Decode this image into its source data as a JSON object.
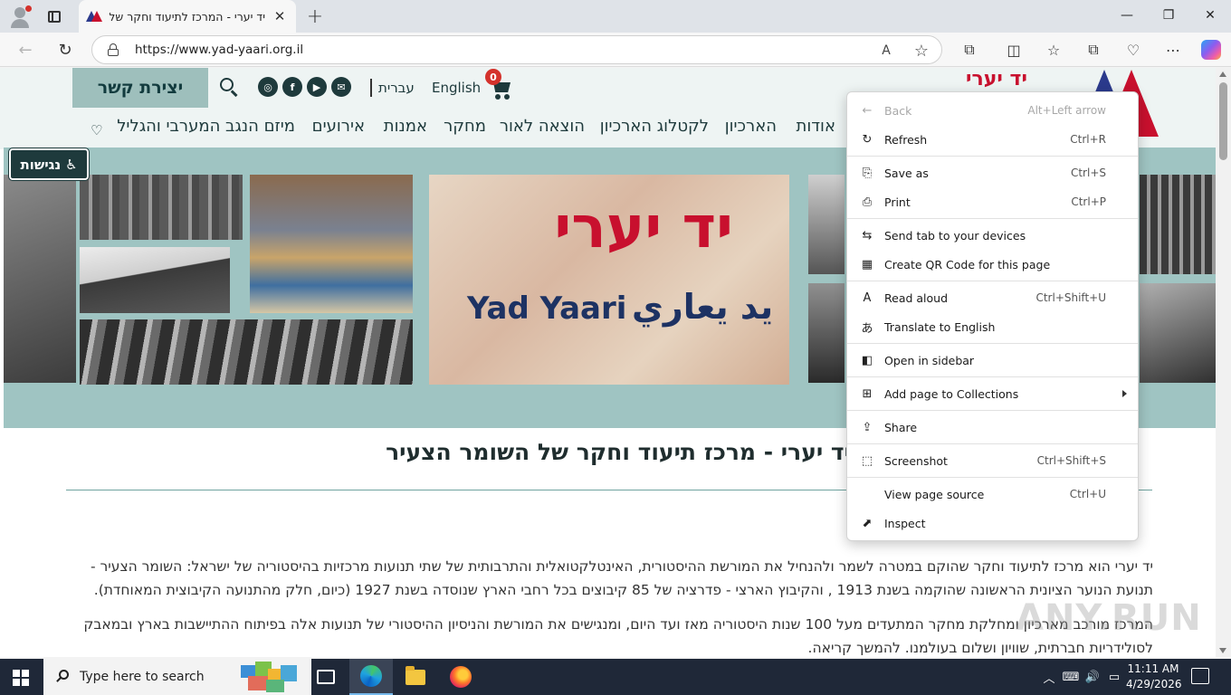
{
  "browser": {
    "tab_title": "יד יערי - המרכז לתיעוד וחקר של ה",
    "tab_close": "✕",
    "new_tab": "+",
    "url": "https://www.yad-yaari.org.il",
    "win_minimize": "—",
    "win_restore": "❐",
    "win_close": "✕",
    "back_glyph": "←",
    "refresh_glyph": "↻",
    "read_aloud_glyph": "A",
    "favorite_glyph": "☆",
    "extensions_glyph": "⧉",
    "split_glyph": "◫",
    "favorites_glyph": "☆",
    "collections_glyph": "⧉",
    "performance_glyph": "♡",
    "more_glyph": "⋯"
  },
  "site": {
    "contact_label": "יצירת קשר",
    "lang_hebrew": "עברית",
    "lang_english": "English",
    "cart_count": "0",
    "brand_text": "יד יערי",
    "social": [
      "◎",
      "f",
      "▶",
      "✉"
    ],
    "nav": [
      {
        "label": "אודות"
      },
      {
        "label": "הארכיון"
      },
      {
        "label": "לקטלוג הארכיון"
      },
      {
        "label": "הוצאה לאור"
      },
      {
        "label": "מחקר"
      },
      {
        "label": "אמנות"
      },
      {
        "label": "אירועים"
      },
      {
        "label": "מיזם הנגב המערבי והגליל"
      }
    ],
    "heart_glyph": "♡",
    "accessibility_label": "נגישות",
    "accessibility_glyph": "♿",
    "poster_hebrew": "יד יערי",
    "poster_english": "Yad Yaari",
    "poster_arabic": "يد يعاري",
    "main_title": "יד יערי - מרכז תיעוד וחקר של השומר הצעיר",
    "paragraph1": "יד יערי הוא מרכז לתיעוד וחקר שהוקם במטרה לשמר ולהנחיל את המורשת ההיסטורית, האינטלקטואלית והתרבותית של שתי תנועות מרכזיות בהיסטוריה של ישראל: השומר הצעיר - תנועת הנוער הציונית הראשונה שהוקמה בשנת 1913 , והקיבוץ הארצי - פדרציה של 85 קיבוצים בכל רחבי הארץ שנוסדה בשנת 1927 (כיום, חלק מהתנועה הקיבוצית המאוחדת).",
    "paragraph2": "המרכז מורכב מארכיון ומחלקת מחקר המתעדים מעל 100 שנות היסטוריה מאז ועד היום, ומנגישים את המורשת והניסיון ההיסטורי של תנועות אלה בפיתוח ההתיישבות בארץ ובמאבק לסולידריות חברתית, שוויון ושלום בעולמנו. להמשך קריאה."
  },
  "context_menu": {
    "items": [
      {
        "label": "Back",
        "shortcut": "Alt+Left arrow",
        "icon": "←",
        "disabled": true
      },
      {
        "label": "Refresh",
        "shortcut": "Ctrl+R",
        "icon": "↻"
      },
      {
        "label": "Save as",
        "shortcut": "Ctrl+S",
        "icon": "⎘"
      },
      {
        "label": "Print",
        "shortcut": "Ctrl+P",
        "icon": "⎙"
      },
      {
        "label": "Send tab to your devices",
        "shortcut": "",
        "icon": "⇆"
      },
      {
        "label": "Create QR Code for this page",
        "shortcut": "",
        "icon": "▦"
      },
      {
        "label": "Read aloud",
        "shortcut": "Ctrl+Shift+U",
        "icon": "A"
      },
      {
        "label": "Translate to English",
        "shortcut": "",
        "icon": "あ"
      },
      {
        "label": "Open in sidebar",
        "shortcut": "",
        "icon": "◧"
      },
      {
        "label": "Add page to Collections",
        "shortcut": "",
        "icon": "⊞"
      },
      {
        "label": "Share",
        "shortcut": "",
        "icon": "⇪"
      },
      {
        "label": "Screenshot",
        "shortcut": "Ctrl+Shift+S",
        "icon": "⬚"
      },
      {
        "label": "View page source",
        "shortcut": "Ctrl+U",
        "icon": ""
      },
      {
        "label": "Inspect",
        "shortcut": "",
        "icon": "⬈"
      }
    ]
  },
  "taskbar": {
    "search_placeholder": "Type here to search",
    "time": "11:11 AM",
    "date": "4/29/2026",
    "tray_chevron": "︿",
    "tray_keyboard": "⌨",
    "tray_volume": "🔊",
    "tray_network": "▭"
  },
  "watermark": "ANY.RUN",
  "colors": {
    "site_dark": "#1e3a3c",
    "site_teal": "#9fc4c2",
    "brand_red": "#c8102e",
    "brand_blue": "#2b3a8c"
  }
}
